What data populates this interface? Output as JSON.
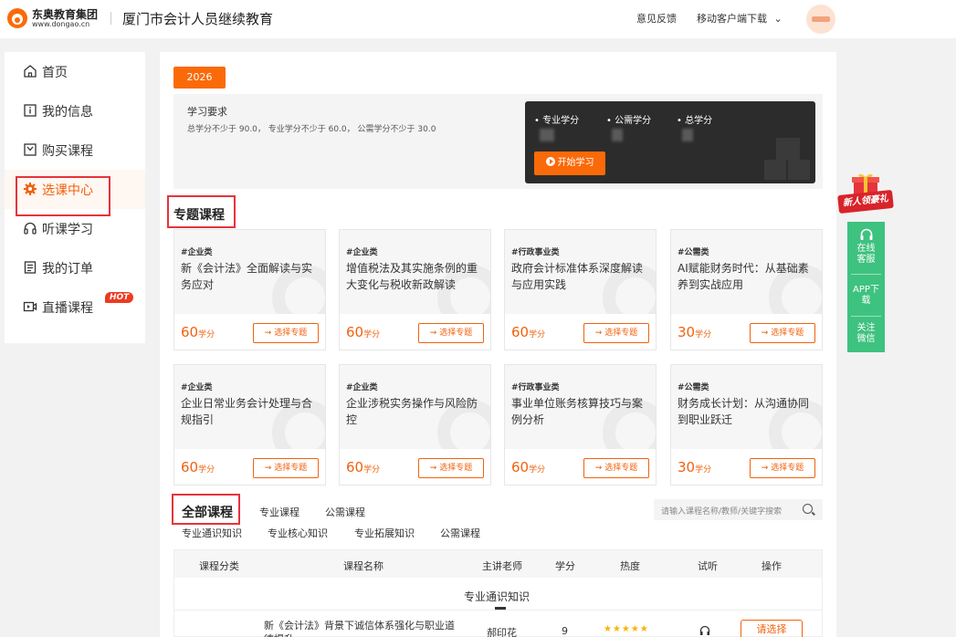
{
  "header": {
    "logo_name": "东奥教育集团",
    "logo_url": "www.dongao.cn",
    "site_title": "厦门市会计人员继续教育",
    "feedback": "意见反馈",
    "mobile_download": "移动客户端下载",
    "mobile_chevron": "⌄"
  },
  "sidebar": {
    "items": [
      {
        "label": "首页",
        "icon": "home-icon"
      },
      {
        "label": "我的信息",
        "icon": "info-icon"
      },
      {
        "label": "购买课程",
        "icon": "cart-box-icon"
      },
      {
        "label": "选课中心",
        "icon": "gear-icon"
      },
      {
        "label": "听课学习",
        "icon": "headphones-icon"
      },
      {
        "label": "我的订单",
        "icon": "order-icon"
      },
      {
        "label": "直播课程",
        "icon": "live-camera-icon"
      }
    ],
    "active_index": 3,
    "hot_badge": "HOT"
  },
  "year_tab": "2026",
  "requirements": {
    "title": "学习要求",
    "text": "总学分不少于 90.0， 专业学分不少于 60.0， 公需学分不少于 30.0",
    "stats": [
      {
        "label": "• 专业学分"
      },
      {
        "label": "• 公需学分"
      },
      {
        "label": "• 总学分"
      }
    ],
    "start_button": "开始学习"
  },
  "featured": {
    "title": "专题课程",
    "cards": [
      {
        "tag": "#企业类",
        "name": "新《会计法》全面解读与实务应对",
        "credit": "60",
        "unit": "学分",
        "button": "选择专题"
      },
      {
        "tag": "#企业类",
        "name": "增值税法及其实施条例的重大变化与税收新政解读",
        "credit": "60",
        "unit": "学分",
        "button": "选择专题"
      },
      {
        "tag": "#行政事业类",
        "name": "政府会计标准体系深度解读与应用实践",
        "credit": "60",
        "unit": "学分",
        "button": "选择专题"
      },
      {
        "tag": "#公需类",
        "name": "AI赋能财务时代：从基础素养到实战应用",
        "credit": "30",
        "unit": "学分",
        "button": "选择专题"
      },
      {
        "tag": "#企业类",
        "name": "企业日常业务会计处理与合规指引",
        "credit": "60",
        "unit": "学分",
        "button": "选择专题"
      },
      {
        "tag": "#企业类",
        "name": "企业涉税实务操作与风险防控",
        "credit": "60",
        "unit": "学分",
        "button": "选择专题"
      },
      {
        "tag": "#行政事业类",
        "name": "事业单位账务核算技巧与案例分析",
        "credit": "60",
        "unit": "学分",
        "button": "选择专题"
      },
      {
        "tag": "#公需类",
        "name": "财务成长计划：从沟通协同到职业跃迁",
        "credit": "30",
        "unit": "学分",
        "button": "选择专题"
      }
    ]
  },
  "all_courses": {
    "title": "全部课程",
    "tabs": [
      "专业课程",
      "公需课程"
    ],
    "sub_tabs": [
      "专业通识知识",
      "专业核心知识",
      "专业拓展知识",
      "公需课程"
    ],
    "search_placeholder": "请输入课程名称/教师/关键字搜索"
  },
  "table": {
    "headers": [
      "课程分类",
      "课程名称",
      "主讲老师",
      "学分",
      "热度",
      "试听",
      "操作"
    ],
    "group_label": "专业通识知识",
    "rows": [
      {
        "name": "新《会计法》背景下诚信体系强化与职业道德提升",
        "teacher": "郝印花",
        "credit": "9",
        "stars": "★★★★★",
        "button": "请选择"
      }
    ]
  },
  "float_panel": {
    "gift_label": "新人领豪礼",
    "items": [
      {
        "label": "在线客服",
        "icon": "headset-icon"
      },
      {
        "label": "APP下载"
      },
      {
        "label": "关注微信"
      }
    ]
  },
  "colors": {
    "accent": "#fb6a09",
    "highlight_border": "#e5343b",
    "float_green": "#3ec27f"
  }
}
